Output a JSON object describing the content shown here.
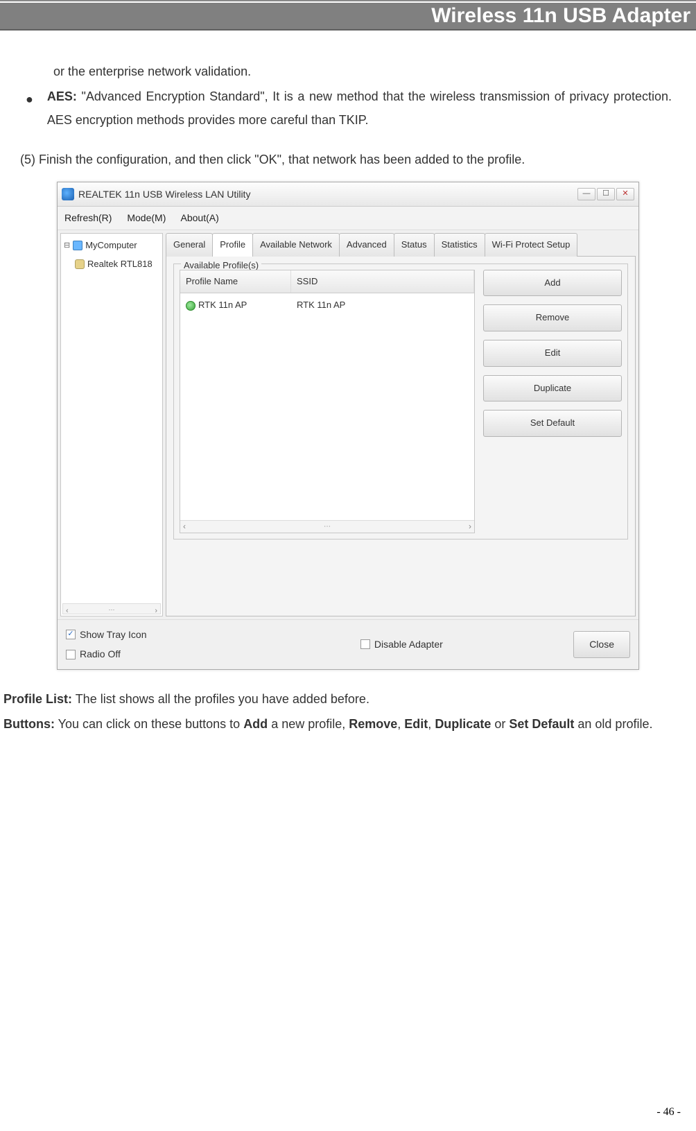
{
  "header": {
    "title": "Wireless 11n USB Adapter"
  },
  "text": {
    "line1": "or the enterprise network validation.",
    "aes_label": "AES:",
    "aes_text": " \"Advanced Encryption Standard\", It is a new method that the wireless transmission of privacy protection. AES encryption methods provides more careful than TKIP.",
    "step5": "(5) Finish the configuration, and then click \"OK\", that network has been added to the profile.",
    "profile_list_label": "Profile List:",
    "profile_list_text": " The list shows all the profiles you have added before.",
    "buttons_label": "Buttons:",
    "buttons_text_1": " You can click on these buttons to ",
    "buttons_add": "Add",
    "buttons_text_2": " a new profile, ",
    "buttons_remove": "Remove",
    "buttons_text_3": ", ",
    "buttons_edit": "Edit",
    "buttons_text_4": ", ",
    "buttons_duplicate": "Duplicate",
    "buttons_text_5": " or ",
    "buttons_setdefault": "Set Default",
    "buttons_text_6": " an old profile."
  },
  "app": {
    "title": "REALTEK 11n USB Wireless LAN Utility",
    "menu": {
      "refresh": "Refresh(R)",
      "mode": "Mode(M)",
      "about": "About(A)"
    },
    "tree": {
      "root": "MyComputer",
      "child": "Realtek RTL818"
    },
    "tabs": {
      "general": "General",
      "profile": "Profile",
      "available": "Available Network",
      "advanced": "Advanced",
      "status": "Status",
      "statistics": "Statistics",
      "wps": "Wi-Fi Protect Setup"
    },
    "group": {
      "title": "Available Profile(s)"
    },
    "list": {
      "col_name": "Profile Name",
      "col_ssid": "SSID",
      "row": {
        "name": "RTK 11n AP",
        "ssid": "RTK 11n AP"
      }
    },
    "buttons": {
      "add": "Add",
      "remove": "Remove",
      "edit": "Edit",
      "duplicate": "Duplicate",
      "setdefault": "Set Default"
    },
    "bottom": {
      "tray": "Show Tray Icon",
      "radio": "Radio Off",
      "disable": "Disable Adapter",
      "close": "Close"
    },
    "win": {
      "min": "—",
      "max": "☐",
      "close": "✕"
    }
  },
  "page_number": "- 46 -"
}
